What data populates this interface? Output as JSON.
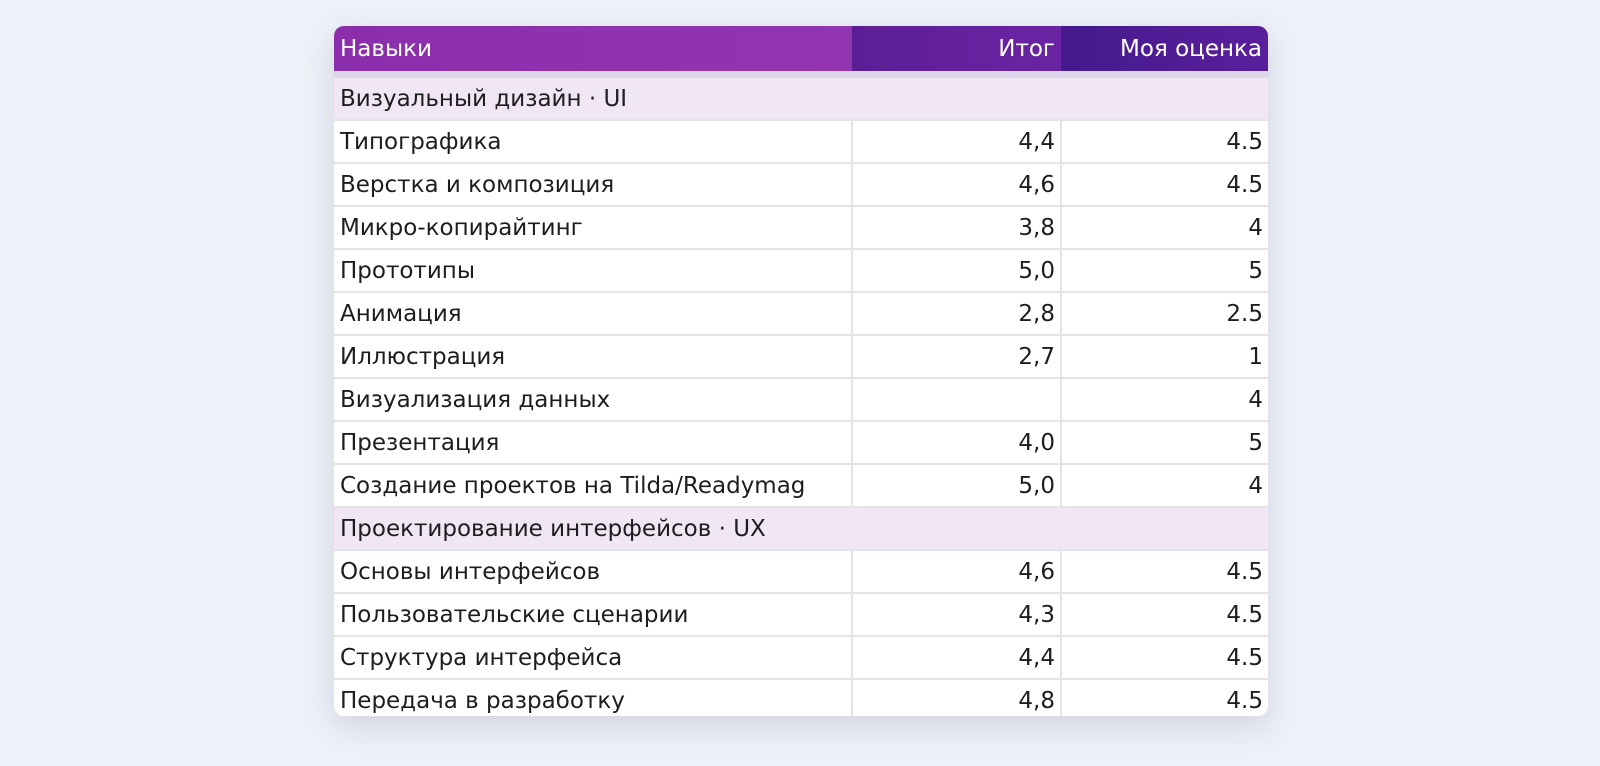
{
  "table": {
    "headers": {
      "skill": "Навыки",
      "total": "Итог",
      "self": "Моя оценка"
    },
    "colors": {
      "header_skill": "#8e31ad",
      "header_total": "#6321a0",
      "header_self": "#4d1c93",
      "section_row": "#f1e6f4"
    },
    "sections": [
      {
        "title": "Визуальный дизайн · UI",
        "rows": [
          {
            "skill": "Типографика",
            "total": "4,4",
            "self": "4.5"
          },
          {
            "skill": "Верстка и композиция",
            "total": "4,6",
            "self": "4.5"
          },
          {
            "skill": "Микро-копирайтинг",
            "total": "3,8",
            "self": "4"
          },
          {
            "skill": "Прототипы",
            "total": "5,0",
            "self": "5"
          },
          {
            "skill": "Анимация",
            "total": "2,8",
            "self": "2.5"
          },
          {
            "skill": "Иллюстрация",
            "total": "2,7",
            "self": "1"
          },
          {
            "skill": "Визуализация данных",
            "total": "",
            "self": "4"
          },
          {
            "skill": "Презентация",
            "total": "4,0",
            "self": "5"
          },
          {
            "skill": "Создание проектов на Tilda/Readymag",
            "total": "5,0",
            "self": "4"
          }
        ]
      },
      {
        "title": "Проектирование интерфейсов · UX",
        "rows": [
          {
            "skill": "Основы интерфейсов",
            "total": "4,6",
            "self": "4.5"
          },
          {
            "skill": "Пользовательские сценарии",
            "total": "4,3",
            "self": "4.5"
          },
          {
            "skill": "Структура интерфейса",
            "total": "4,4",
            "self": "4.5"
          },
          {
            "skill": "Передача в разработку",
            "total": "4,8",
            "self": "4.5"
          }
        ]
      }
    ]
  }
}
